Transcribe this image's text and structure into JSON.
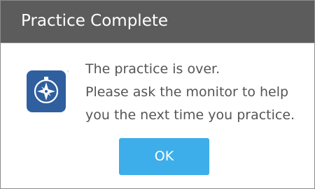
{
  "dialog": {
    "title": "Practice Complete",
    "icon": "compass-app-icon",
    "message_lines": [
      "The practice is over.",
      "Please ask the monitor to help",
      "you the next time you practice."
    ],
    "ok_label": "OK"
  },
  "colors": {
    "titlebar": "#5c5c5c",
    "title_text": "#ffffff",
    "message_text": "#555555",
    "button": "#3daee9",
    "icon_background": "#2f5f9f"
  }
}
